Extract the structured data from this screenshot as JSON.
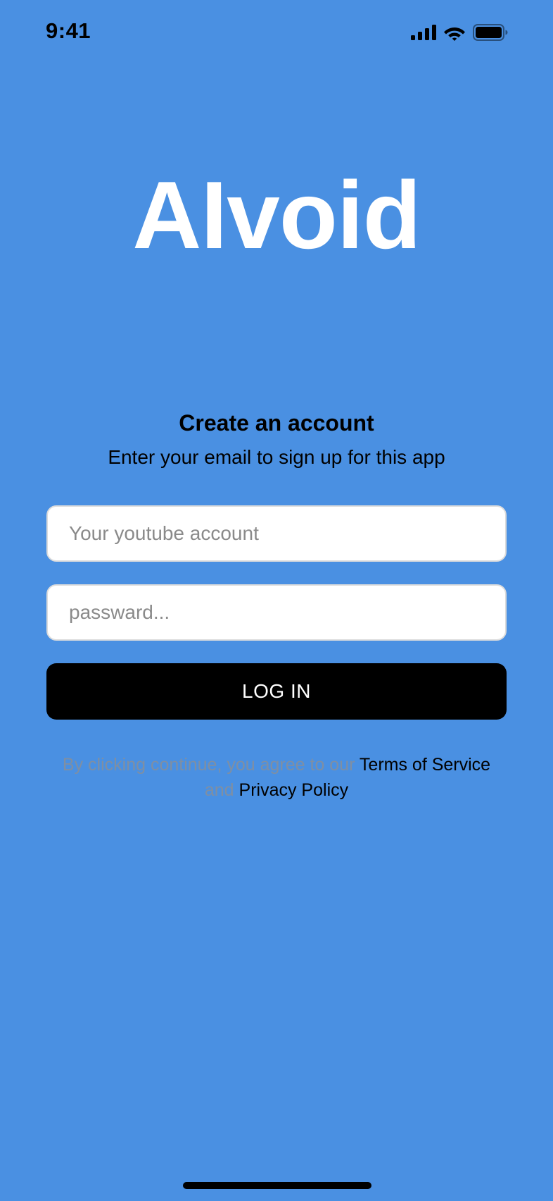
{
  "status_bar": {
    "time": "9:41",
    "icons": [
      "cellular-signal-icon",
      "wifi-icon",
      "battery-icon"
    ]
  },
  "app": {
    "logo_text": "AIvoid"
  },
  "signup": {
    "title": "Create an account",
    "subtitle": "Enter your email to sign up for this app",
    "email_placeholder": "Your youtube account",
    "email_value": "",
    "password_placeholder": "passward...",
    "password_value": "",
    "login_label": "LOG IN"
  },
  "legal": {
    "prefix": "By clicking continue, you agree to our ",
    "terms_label": "Terms of Service",
    "conjunction": " and ",
    "privacy_label": "Privacy Policy"
  },
  "colors": {
    "background": "#4a90e2",
    "primary_button": "#000000",
    "logo_text": "#ffffff",
    "legal_muted": "#7f8fa3"
  }
}
